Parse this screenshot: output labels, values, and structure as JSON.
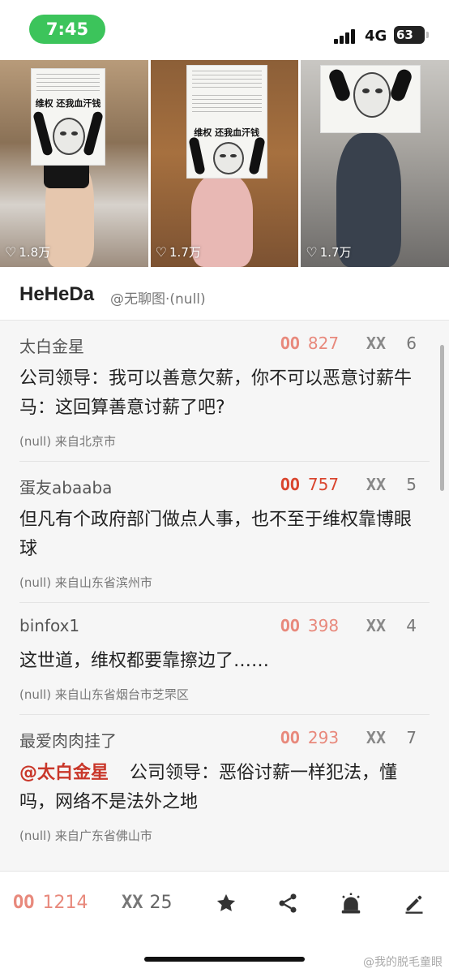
{
  "status_bar": {
    "time": "7:45",
    "network": "4G",
    "battery": "63"
  },
  "thumbnails": [
    {
      "likes": "1.8万",
      "sign_text": "维权 还我血汗钱"
    },
    {
      "likes": "1.7万",
      "sign_text": "维权 还我血汗钱"
    },
    {
      "likes": "1.7万"
    }
  ],
  "author": {
    "name": "HeHeDa",
    "sub": "@无聊图·(null)"
  },
  "vote_labels": {
    "up": "OO",
    "down": "XX"
  },
  "comments": [
    {
      "user": "太白金星",
      "up": "827",
      "down": "6",
      "text": "公司领导：我可以善意欠薪，你不可以恶意讨薪牛马：这回算善意讨薪了吧?",
      "meta": "(null) 来自北京市"
    },
    {
      "user": "蛋友abaaba",
      "up": "757",
      "down": "5",
      "text": "但凡有个政府部门做点人事，也不至于维权靠博眼球",
      "meta": "(null) 来自山东省滨州市"
    },
    {
      "user": "binfox1",
      "up": "398",
      "down": "4",
      "text": "这世道，维权都要靠擦边了……",
      "meta": "(null) 来自山东省烟台市芝罘区"
    },
    {
      "user": "最爱肉肉挂了",
      "up": "293",
      "down": "7",
      "mention": "@太白金星",
      "text": "公司领导：恶俗讨薪一样犯法，懂吗，网络不是法外之地",
      "meta": "(null) 来自广东省佛山市"
    }
  ],
  "bottom_bar": {
    "up_count": "1214",
    "down_count": "25",
    "icons": [
      "star-icon",
      "share-icon",
      "alarm-icon",
      "edit-icon"
    ]
  },
  "watermark": "@我的脱毛童眼",
  "colors": {
    "status_green": "#3cc45b",
    "up_color": "#e8897c",
    "hot_up_color": "#d9452e",
    "mention": "#c9372a"
  }
}
